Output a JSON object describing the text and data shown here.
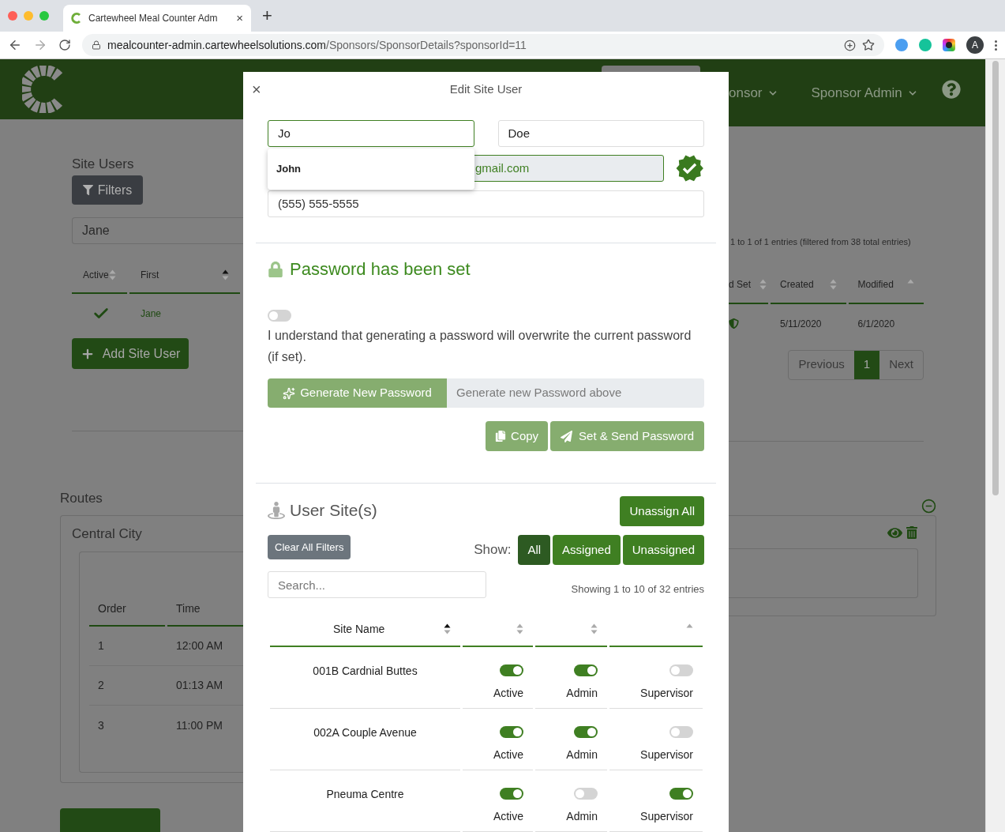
{
  "browser": {
    "tab_title": "Cartewheel Meal Counter Adm",
    "tab_close": "×",
    "new_tab": "+",
    "url_host": "mealcounter-admin.cartewheelsolutions.com",
    "url_path": "/Sponsors/SponsorDetails?sponsorId=11",
    "avatar_letter": "A"
  },
  "header": {
    "menus": [
      "onsor",
      "Sponsor Admin"
    ]
  },
  "site_users": {
    "title": "Site Users",
    "filters_button": "Filters",
    "search_value": "Jane",
    "columns": [
      {
        "label": "Active",
        "sorted": false,
        "down_arrow": true
      },
      {
        "label": "First",
        "sorted": true,
        "down_arrow": true
      }
    ],
    "row": {
      "active": true,
      "first": "Jane"
    },
    "add_button": "Add Site User"
  },
  "routes": {
    "title": "Routes",
    "card_title": "Central City",
    "columns": [
      "Order",
      "Time"
    ],
    "rows": [
      {
        "order": "1",
        "time": "12:00 AM"
      },
      {
        "order": "2",
        "time": "01:13 AM"
      },
      {
        "order": "3",
        "time": "11:00 PM"
      }
    ]
  },
  "right_panel": {
    "entries_info": "1 to 1 of 1 entries (filtered from 38 total entries)",
    "columns": [
      {
        "label": "d Set",
        "sorted": false,
        "down_arrow": true
      },
      {
        "label": "Created",
        "sorted": false,
        "down_arrow": true
      },
      {
        "label": "Modified",
        "sorted": false,
        "down_arrow": false
      }
    ],
    "row": [
      "5/11/2020",
      "6/1/2020"
    ],
    "pagination": [
      {
        "label": "Previous",
        "selected": false
      },
      {
        "label": "1",
        "selected": true
      },
      {
        "label": "Next",
        "selected": false
      }
    ]
  },
  "modal": {
    "title": "Edit Site User",
    "close": "×",
    "first_name": "Jo",
    "last_name": "Doe",
    "email_visible": "gmail.com",
    "email_verified": true,
    "phone": "(555) 555-5555",
    "autocomplete": [
      "John"
    ],
    "password": {
      "title": "Password has been set",
      "confirm_on": false,
      "confirm_text": "I understand that generating a password will overwrite the current password (if set).",
      "generate_button": "Generate New Password",
      "generated_placeholder": "Generate new Password above",
      "copy_button": "Copy",
      "send_button": "Set & Send Password"
    },
    "sites": {
      "title": "User Site(s)",
      "unassign_all": "Unassign All",
      "clear_filters": "Clear All Filters",
      "show_label": "Show:",
      "filters": [
        {
          "label": "All",
          "selected": true
        },
        {
          "label": "Assigned",
          "selected": false
        },
        {
          "label": "Unassigned",
          "selected": false
        }
      ],
      "search_placeholder": "Search...",
      "info": "Showing 1 to 10 of 32 entries",
      "columns": [
        {
          "label": "Site Name",
          "sorted": true,
          "down_arrow": true
        },
        {
          "sorted": false,
          "down_arrow": true
        },
        {
          "sorted": false,
          "down_arrow": true
        },
        {
          "sorted": false,
          "down_arrow": false
        }
      ],
      "rows": [
        {
          "name": "001B Cardnial Buttes",
          "toggles": [
            {
              "label": "Active",
              "on": true
            },
            {
              "label": "Admin",
              "on": true
            },
            {
              "label": "Supervisor",
              "on": false
            }
          ]
        },
        {
          "name": "002A Couple Avenue",
          "toggles": [
            {
              "label": "Active",
              "on": true
            },
            {
              "label": "Admin",
              "on": true
            },
            {
              "label": "Supervisor",
              "on": false
            }
          ]
        },
        {
          "name": "Pneuma Centre",
          "toggles": [
            {
              "label": "Active",
              "on": true
            },
            {
              "label": "Admin",
              "on": false
            },
            {
              "label": "Supervisor",
              "on": true
            }
          ]
        }
      ]
    }
  }
}
